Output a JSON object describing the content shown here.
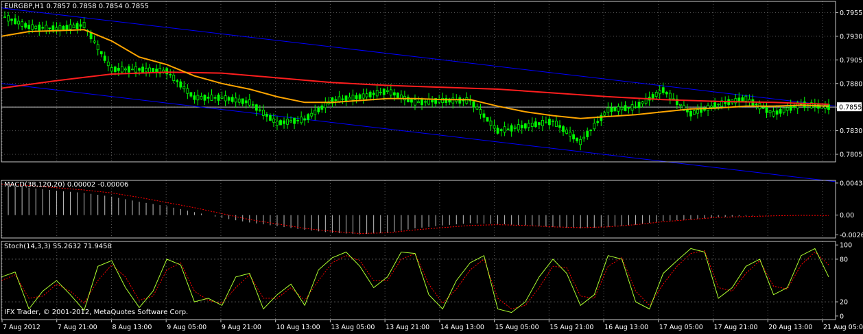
{
  "colors": {
    "background": "#000000",
    "grid": "#5a5a5a",
    "frame": "#c8c8c8",
    "candle_up": "#00ff00",
    "candle_down": "#00ff00",
    "ma_fast": "#ffa500",
    "ma_slow": "#ff1e1e",
    "channel": "#0000ff",
    "macd_hist": "#c0c0c0",
    "macd_signal": "#ff0000",
    "stoch_main": "#adff2f",
    "stoch_signal": "#ff0000",
    "price_line": "#c0c0c0",
    "text": "#ffffff"
  },
  "header": {
    "main_title": "EURGBP,H1  0.7857 0.7858 0.7854 0.7855",
    "macd_title": "MACD(38,120,20) 0.00002 -0.00006",
    "stoch_title": "Stoch(14,3,3) 55.2632 71.9458",
    "footer_text": "IFX Trader, © 2001-2012, MetaQuotes Software Corp."
  },
  "chart_data": [
    {
      "type": "line",
      "panel": "price",
      "symbol": "EURGBP",
      "timeframe": "H1",
      "ohlc_last": {
        "open": 0.7857,
        "high": 0.7858,
        "low": 0.7854,
        "close": 0.7855
      },
      "current_price": "0.7855",
      "y_ticks": [
        "0.7955",
        "0.7930",
        "0.7905",
        "0.7880",
        "0.7855",
        "0.7830",
        "0.7805"
      ],
      "ylim": [
        0.7797,
        0.7967
      ],
      "x_ticks": [
        "7 Aug 2012",
        "7 Aug 21:00",
        "8 Aug 13:00",
        "9 Aug 05:00",
        "9 Aug 21:00",
        "10 Aug 13:00",
        "13 Aug 05:00",
        "13 Aug 21:00",
        "14 Aug 13:00",
        "15 Aug 05:00",
        "15 Aug 21:00",
        "16 Aug 13:00",
        "17 Aug 05:00",
        "17 Aug 21:00",
        "20 Aug 13:00",
        "21 Aug 05:00"
      ],
      "x_index_range": [
        0,
        242
      ],
      "grid": true,
      "series": [
        {
          "type": "candlestick",
          "x": [
            0,
            8,
            16,
            24,
            32,
            40,
            48,
            56,
            64,
            72,
            80,
            88,
            96,
            104,
            112,
            120,
            128,
            136,
            144,
            152,
            160,
            168,
            176,
            184,
            192,
            200,
            208,
            216,
            224,
            232,
            240
          ],
          "close": [
            0.7952,
            0.794,
            0.7938,
            0.7942,
            0.7895,
            0.7895,
            0.7893,
            0.7865,
            0.7865,
            0.786,
            0.7838,
            0.7842,
            0.7862,
            0.7866,
            0.7872,
            0.786,
            0.7862,
            0.7862,
            0.783,
            0.7835,
            0.784,
            0.7818,
            0.7852,
            0.7855,
            0.7873,
            0.7848,
            0.7858,
            0.7864,
            0.7848,
            0.7858,
            0.7855
          ]
        },
        {
          "name": "",
          "type": "line",
          "x": [
            0,
            8,
            16,
            24,
            32,
            40,
            48,
            56,
            64,
            72,
            80,
            88,
            96,
            104,
            112,
            120,
            128,
            136,
            144,
            152,
            160,
            168,
            176,
            184,
            192,
            200,
            208,
            216,
            224,
            232,
            240
          ],
          "values": [
            0.793,
            0.7935,
            0.7936,
            0.7937,
            0.7925,
            0.7908,
            0.79,
            0.7888,
            0.788,
            0.7874,
            0.7866,
            0.786,
            0.786,
            0.7862,
            0.7864,
            0.7864,
            0.7863,
            0.7863,
            0.7856,
            0.785,
            0.7846,
            0.7843,
            0.7845,
            0.7847,
            0.785,
            0.7853,
            0.7854,
            0.7856,
            0.7856,
            0.7857,
            0.7856
          ]
        },
        {
          "name": "",
          "type": "line",
          "x": [
            0,
            16,
            32,
            48,
            64,
            80,
            96,
            112,
            128,
            144,
            160,
            176,
            192,
            208,
            224,
            240
          ],
          "values": [
            0.7875,
            0.7883,
            0.789,
            0.7892,
            0.7891,
            0.7886,
            0.7881,
            0.7878,
            0.7876,
            0.7874,
            0.787,
            0.7866,
            0.7863,
            0.7861,
            0.786,
            0.7858
          ]
        },
        {
          "name": "",
          "type": "line",
          "x": [
            0,
            242
          ],
          "values": [
            0.796,
            0.7856
          ]
        },
        {
          "name": "",
          "type": "line",
          "x": [
            0,
            242
          ],
          "values": [
            0.788,
            0.7776
          ]
        }
      ]
    },
    {
      "type": "bar",
      "panel": "macd",
      "y_ticks": [
        "0.00434",
        "0.00",
        "-0.00268"
      ],
      "ylim": [
        -0.0031,
        0.0047
      ],
      "series": [
        {
          "type": "histogram",
          "x": [
            0,
            8,
            16,
            24,
            32,
            40,
            48,
            56,
            64,
            72,
            80,
            88,
            96,
            104,
            112,
            120,
            128,
            136,
            144,
            152,
            160,
            168,
            176,
            184,
            192,
            200,
            208,
            216,
            224,
            232,
            240
          ],
          "values": [
            0.004,
            0.0037,
            0.0033,
            0.003,
            0.0025,
            0.0018,
            0.0012,
            0.0004,
            -0.0004,
            -0.001,
            -0.0015,
            -0.002,
            -0.0024,
            -0.0026,
            -0.0024,
            -0.0018,
            -0.0014,
            -0.0011,
            -0.0012,
            -0.0014,
            -0.0016,
            -0.0018,
            -0.0016,
            -0.0013,
            -0.0008,
            -0.0006,
            -0.0003,
            -0.0001,
            0.0,
            0.0,
            2e-05
          ]
        },
        {
          "name": "",
          "type": "line",
          "x": [
            0,
            8,
            16,
            24,
            32,
            40,
            48,
            56,
            64,
            72,
            80,
            88,
            96,
            104,
            112,
            120,
            128,
            136,
            144,
            152,
            160,
            168,
            176,
            184,
            192,
            200,
            208,
            216,
            224,
            232,
            240
          ],
          "values": [
            0.0042,
            0.004,
            0.0037,
            0.0034,
            0.003,
            0.0024,
            0.0017,
            0.001,
            0.0002,
            -0.0006,
            -0.0012,
            -0.0018,
            -0.0022,
            -0.0025,
            -0.0024,
            -0.002,
            -0.0017,
            -0.0014,
            -0.0013,
            -0.0014,
            -0.0016,
            -0.0017,
            -0.0016,
            -0.0013,
            -0.0009,
            -0.0006,
            -0.0003,
            -0.0002,
            -0.0001,
            -4e-05,
            -6e-05
          ]
        }
      ]
    },
    {
      "type": "line",
      "panel": "stochastic",
      "y_ticks": [
        "100",
        "80",
        "20",
        "0"
      ],
      "ylim": [
        -5,
        105
      ],
      "series": [
        {
          "name": "",
          "x": [
            0,
            4,
            8,
            12,
            16,
            20,
            24,
            28,
            32,
            36,
            40,
            44,
            48,
            52,
            56,
            60,
            64,
            68,
            72,
            76,
            80,
            84,
            88,
            92,
            96,
            100,
            104,
            108,
            112,
            116,
            120,
            124,
            128,
            132,
            136,
            140,
            144,
            148,
            152,
            156,
            160,
            164,
            168,
            172,
            176,
            180,
            184,
            188,
            192,
            196,
            200,
            204,
            208,
            212,
            216,
            220,
            224,
            228,
            232,
            236,
            240
          ],
          "values": [
            55,
            62,
            10,
            35,
            50,
            30,
            8,
            70,
            78,
            40,
            12,
            35,
            80,
            72,
            20,
            25,
            15,
            55,
            60,
            10,
            30,
            45,
            15,
            65,
            82,
            90,
            70,
            40,
            55,
            90,
            88,
            30,
            10,
            50,
            75,
            85,
            10,
            5,
            20,
            55,
            80,
            60,
            15,
            30,
            85,
            80,
            20,
            10,
            60,
            78,
            95,
            90,
            25,
            40,
            70,
            80,
            30,
            40,
            85,
            95,
            55
          ]
        },
        {
          "name": "",
          "x": [
            0,
            4,
            8,
            12,
            16,
            20,
            24,
            28,
            32,
            36,
            40,
            44,
            48,
            52,
            56,
            60,
            64,
            68,
            72,
            76,
            80,
            84,
            88,
            92,
            96,
            100,
            104,
            108,
            112,
            116,
            120,
            124,
            128,
            132,
            136,
            140,
            144,
            148,
            152,
            156,
            160,
            164,
            168,
            172,
            176,
            180,
            184,
            188,
            192,
            196,
            200,
            204,
            208,
            212,
            216,
            220,
            224,
            228,
            232,
            236,
            240
          ],
          "values": [
            50,
            58,
            25,
            28,
            45,
            35,
            18,
            50,
            72,
            55,
            22,
            28,
            65,
            75,
            35,
            22,
            18,
            40,
            58,
            25,
            25,
            40,
            22,
            50,
            75,
            85,
            78,
            50,
            50,
            80,
            88,
            45,
            18,
            38,
            65,
            80,
            25,
            10,
            15,
            40,
            70,
            68,
            28,
            25,
            70,
            82,
            35,
            15,
            45,
            70,
            88,
            92,
            40,
            35,
            60,
            78,
            42,
            38,
            72,
            90,
            72
          ]
        }
      ]
    }
  ]
}
